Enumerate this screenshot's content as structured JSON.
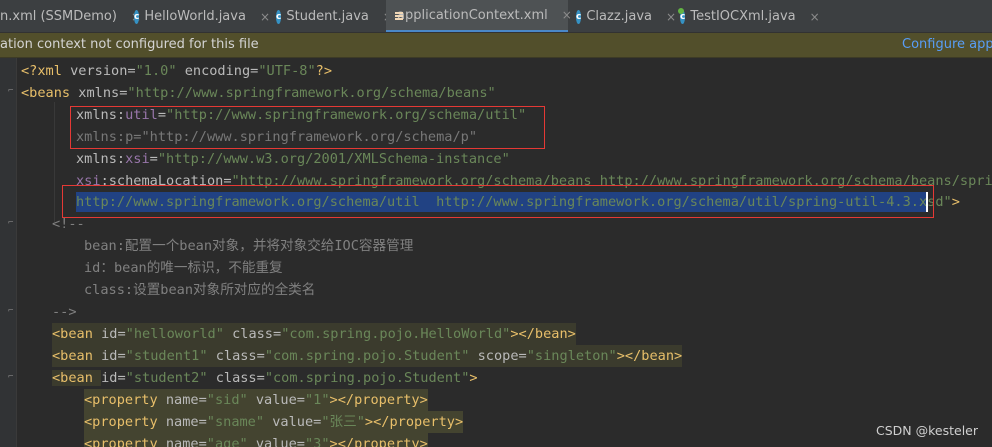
{
  "tabs": [
    {
      "label": "n.xml (SSMDemo)",
      "icon": "maven-xml-icon",
      "active": false
    },
    {
      "label": "HelloWorld.java",
      "icon": "class-c-icon",
      "active": false
    },
    {
      "label": "Student.java",
      "icon": "class-c-icon",
      "active": false
    },
    {
      "label": "applicationContext.xml",
      "icon": "xml-file-icon",
      "active": true
    },
    {
      "label": "Clazz.java",
      "icon": "class-c-icon",
      "active": false
    },
    {
      "label": "TestIOCXml.java",
      "icon": "test-class-icon",
      "active": false
    }
  ],
  "tab_close_glyph": "×",
  "notification": {
    "text": "ation context not configured for this file",
    "link": "Configure appli"
  },
  "code": {
    "l1": {
      "a": "<?xml ",
      "b": "version=",
      "c": "\"1.0\"",
      "d": " encoding=",
      "e": "\"UTF-8\"",
      "f": "?>"
    },
    "l2": {
      "a": "<beans ",
      "b": "xmlns=",
      "c": "\"http://www.springframework.org/schema/beans\""
    },
    "l3": {
      "a": "xmlns:",
      "b": "util",
      "c": "=",
      "d": "\"http://www.springframework.org/schema/util\""
    },
    "l4": {
      "a": "xmlns:",
      "b": "p",
      "c": "=",
      "d": "\"http://www.springframework.org/schema/p\""
    },
    "l5": {
      "a": "xmlns:",
      "b": "xsi",
      "c": "=",
      "d": "\"http://www.w3.org/2001/XMLSchema-instance\""
    },
    "l6": {
      "a": "xsi",
      "b": ":schemaLocation=",
      "c": "\"http://www.springframework.org/schema/beans http://www.springframework.org/schema/beans/spring-"
    },
    "l7": {
      "a": "http://www.springframework.org/schema/util  http://www.springframework.org/schema/util/spring-util-4.3.xsd",
      "b": "\"",
      "c": ">"
    },
    "l8": "<!--",
    "l9": "bean:配置一个bean对象，并将对象交给IOC容器管理",
    "l10": "id：bean的唯一标识，不能重复",
    "l11": "class:设置bean对象所对应的全类名",
    "l12": "-->",
    "l13": {
      "a": "<bean ",
      "b": "id=",
      "c": "\"helloworld\"",
      "d": " class=",
      "e": "\"com.spring.pojo.HelloWorld\"",
      "f": "></bean>"
    },
    "l14": {
      "a": "<bean ",
      "b": "id=",
      "c": "\"student1\"",
      "d": " class=",
      "e": "\"com.spring.pojo.Student\"",
      "f": " scope=",
      "g": "\"singleton\"",
      "h": "></bean>"
    },
    "l15": {
      "a": "<bean ",
      "b": "id=",
      "c": "\"student2\"",
      "d": " class=",
      "e": "\"com.spring.pojo.Student\"",
      "f": ">"
    },
    "l16": {
      "a": "<property ",
      "b": "name=",
      "c": "\"sid\"",
      "d": " value=",
      "e": "\"1\"",
      "f": "></property>"
    },
    "l17": {
      "a": "<property ",
      "b": "name=",
      "c": "\"sname\"",
      "d": " value=",
      "e": "\"张三\"",
      "f": "></property>"
    },
    "l18": {
      "a": "<property ",
      "b": "name=",
      "c": "\"age\"",
      "d": " value=",
      "e": "\"3\"",
      "f": "></property>"
    }
  },
  "watermark": "CSDN @kesteler"
}
